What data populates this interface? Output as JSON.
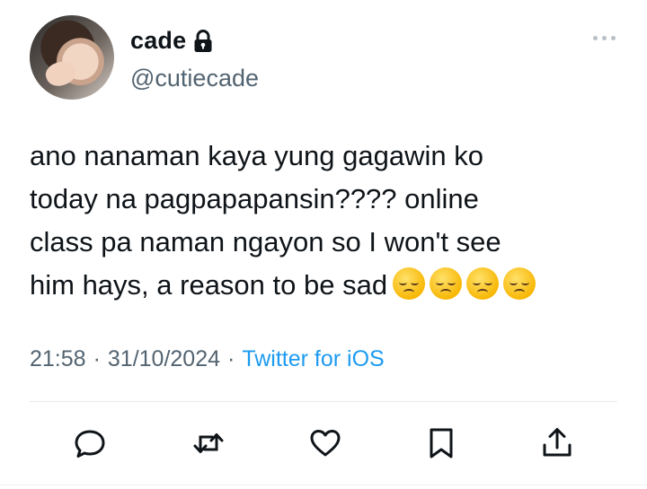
{
  "user": {
    "display_name": "cade",
    "handle": "@cutiecade",
    "protected": true
  },
  "tweet": {
    "text": "ano nanaman kaya yung gagawin ko\ntoday na pagpapapansin???? online\nclass pa naman ngayon so I won't see\nhim hays, a reason to be sad",
    "emojis": [
      "disappointed-face",
      "disappointed-face",
      "disappointed-face",
      "disappointed-face"
    ]
  },
  "meta": {
    "time": "21:58",
    "separator": "·",
    "date": "31/10/2024",
    "source": "Twitter for iOS"
  },
  "actions": [
    "reply-icon",
    "retweet-icon",
    "like-icon",
    "bookmark-icon",
    "share-icon"
  ],
  "colors": {
    "text": "#0f1419",
    "secondary": "#536471",
    "accent": "#1d9bf0"
  }
}
